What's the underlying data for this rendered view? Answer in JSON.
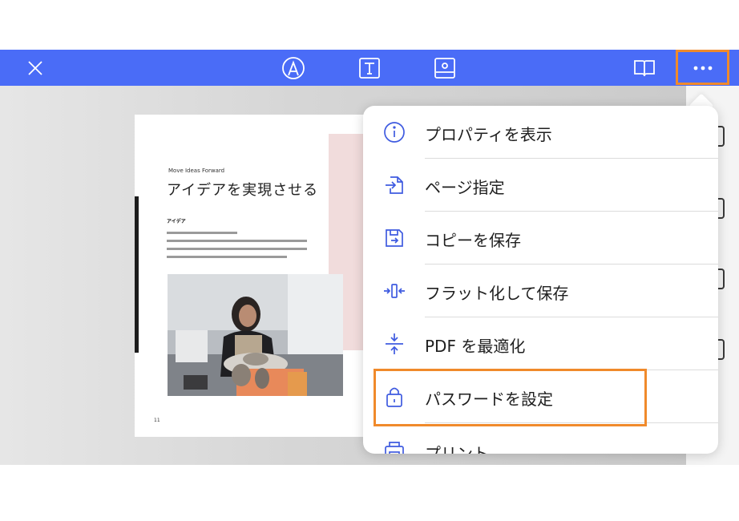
{
  "toolbar": {
    "close_icon": "close-icon",
    "tools": [
      "draw-icon",
      "text-icon",
      "image-icon"
    ],
    "read_mode_icon": "book-icon",
    "more_icon": "more-icon",
    "accent": "#4a6cf7",
    "highlight": "#f08a2b"
  },
  "document": {
    "small_title": "Move Ideas Forward",
    "heading": "アイデアを実現させる",
    "subheading": "アイデア",
    "page_number": "11"
  },
  "menu": {
    "items": [
      {
        "label": "プロパティを表示",
        "icon": "info-icon"
      },
      {
        "label": "ページ指定",
        "icon": "page-jump-icon"
      },
      {
        "label": "コピーを保存",
        "icon": "save-copy-icon"
      },
      {
        "label": "フラット化して保存",
        "icon": "flatten-icon"
      },
      {
        "label": "PDF を最適化",
        "icon": "optimize-icon"
      },
      {
        "label": "パスワードを設定",
        "icon": "lock-icon"
      },
      {
        "label": "プリント",
        "icon": "print-icon"
      }
    ]
  }
}
